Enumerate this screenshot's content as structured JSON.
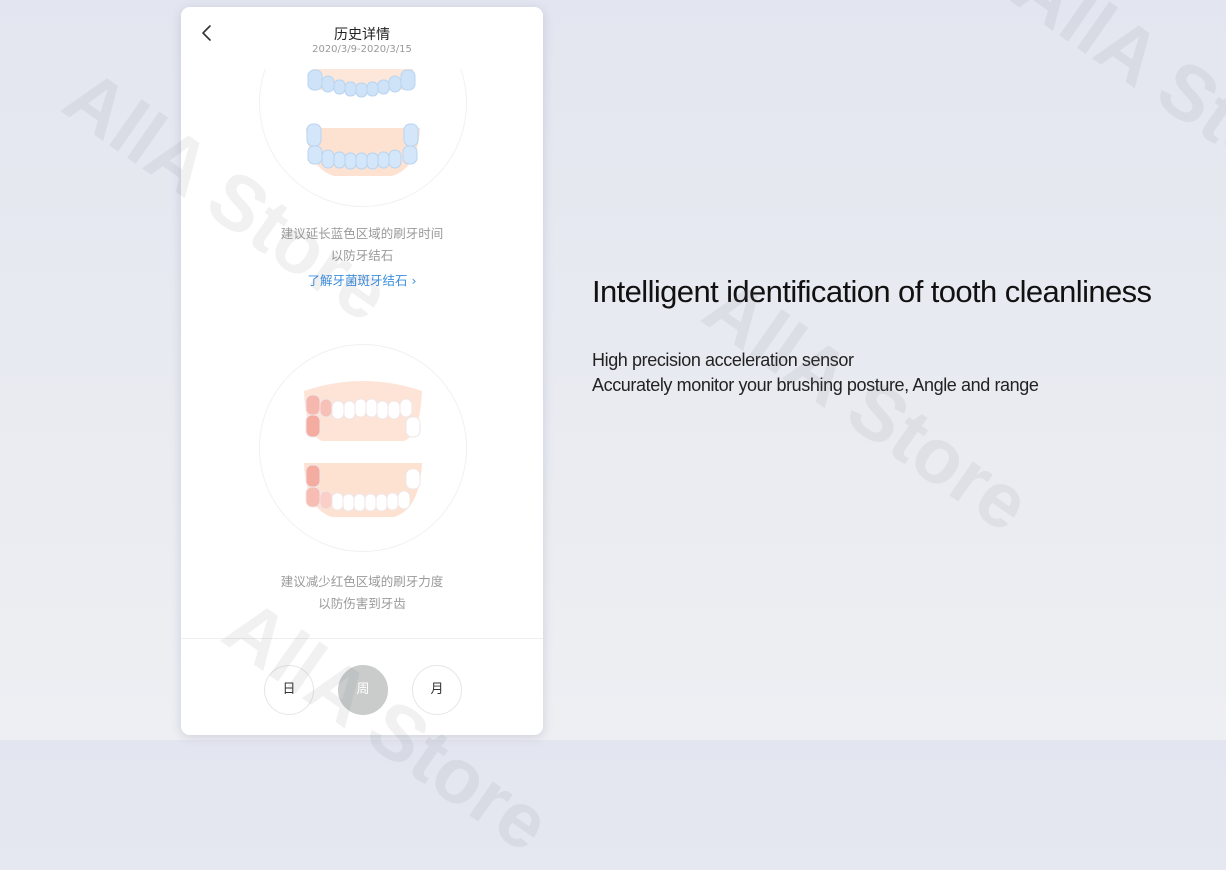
{
  "screen": {
    "title": "历史详情",
    "date_range": "2020/3/9-2020/3/15",
    "upper_section": {
      "hint_line1": "建议延长蓝色区域的刷牙时间",
      "hint_line2": "以防牙结石",
      "link_label": "了解牙菌斑牙结石 ›",
      "highlight_color": "#c3dcf5"
    },
    "lower_section": {
      "hint_line1": "建议减少红色区域的刷牙力度",
      "hint_line2": "以防伤害到牙齿",
      "highlight_color": "#f4b3aa"
    },
    "tabs": [
      {
        "label": "日",
        "active": false
      },
      {
        "label": "周",
        "active": true
      },
      {
        "label": "月",
        "active": false
      }
    ]
  },
  "promo": {
    "headline": "Intelligent identification of tooth cleanliness",
    "line1": "High precision acceleration sensor",
    "line2": "Accurately monitor your brushing posture, Angle and range"
  },
  "watermark_text": "AllA Store",
  "icons": {
    "back": "chevron-left-icon"
  }
}
